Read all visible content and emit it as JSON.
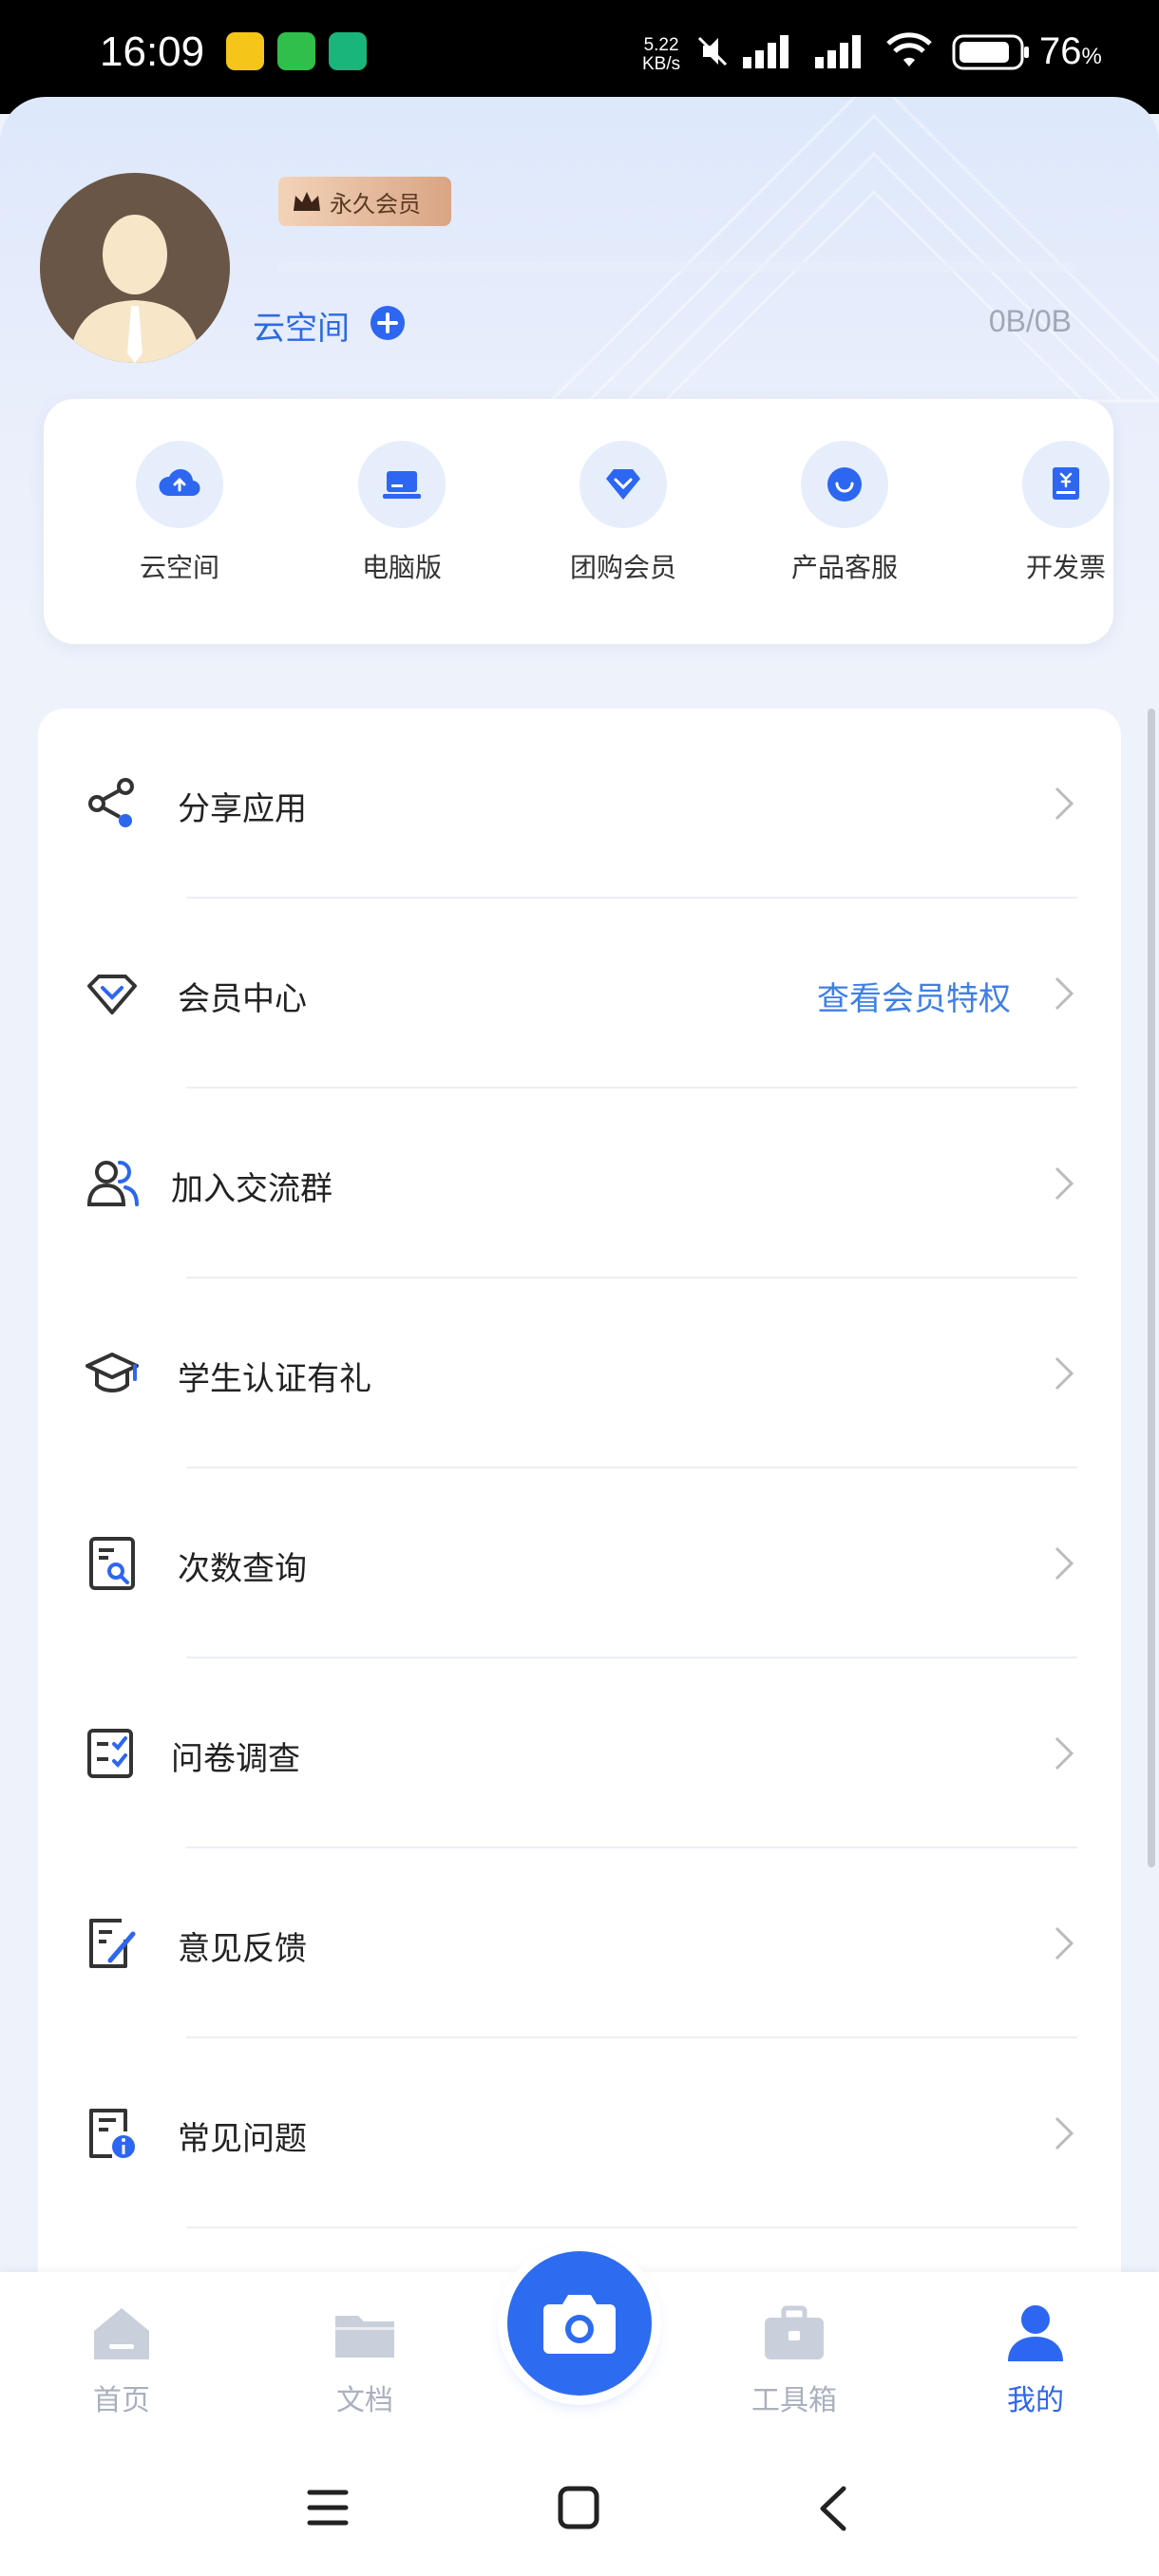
{
  "status_bar": {
    "time": "16:09",
    "net_speed_value": "5.22",
    "net_speed_unit": "KB/s",
    "battery": "76",
    "battery_unit": "%"
  },
  "profile": {
    "badge": "永久会员",
    "cloud_label": "云空间",
    "storage": "0B/0B"
  },
  "quick_actions": [
    {
      "label": "云空间",
      "icon": "cloud-upload-icon"
    },
    {
      "label": "电脑版",
      "icon": "laptop-icon"
    },
    {
      "label": "团购会员",
      "icon": "diamond-icon"
    },
    {
      "label": "产品客服",
      "icon": "chat-smile-icon"
    },
    {
      "label": "开发票",
      "icon": "invoice-icon"
    }
  ],
  "menu": [
    {
      "label": "分享应用",
      "extra": "",
      "icon": "share-icon"
    },
    {
      "label": "会员中心",
      "extra": "查看会员特权",
      "icon": "diamond-outline-icon"
    },
    {
      "label": "加入交流群",
      "extra": "",
      "icon": "group-icon"
    },
    {
      "label": "学生认证有礼",
      "extra": "",
      "icon": "graduation-cap-icon"
    },
    {
      "label": "次数查询",
      "extra": "",
      "icon": "doc-search-icon"
    },
    {
      "label": "问卷调查",
      "extra": "",
      "icon": "checklist-icon"
    },
    {
      "label": "意见反馈",
      "extra": "",
      "icon": "feedback-edit-icon"
    },
    {
      "label": "常见问题",
      "extra": "",
      "icon": "faq-doc-icon"
    }
  ],
  "tabs": [
    {
      "label": "首页",
      "icon": "home-icon",
      "active": false
    },
    {
      "label": "文档",
      "icon": "folder-icon",
      "active": false
    },
    {
      "label": "工具箱",
      "icon": "toolbox-icon",
      "active": false
    },
    {
      "label": "我的",
      "icon": "person-icon",
      "active": true
    }
  ],
  "colors": {
    "accent": "#2d66f0",
    "link": "#3f7fe6",
    "badge_start": "#f3d3b8",
    "badge_end": "#d9a585",
    "inactive_tab": "#aab0be"
  }
}
